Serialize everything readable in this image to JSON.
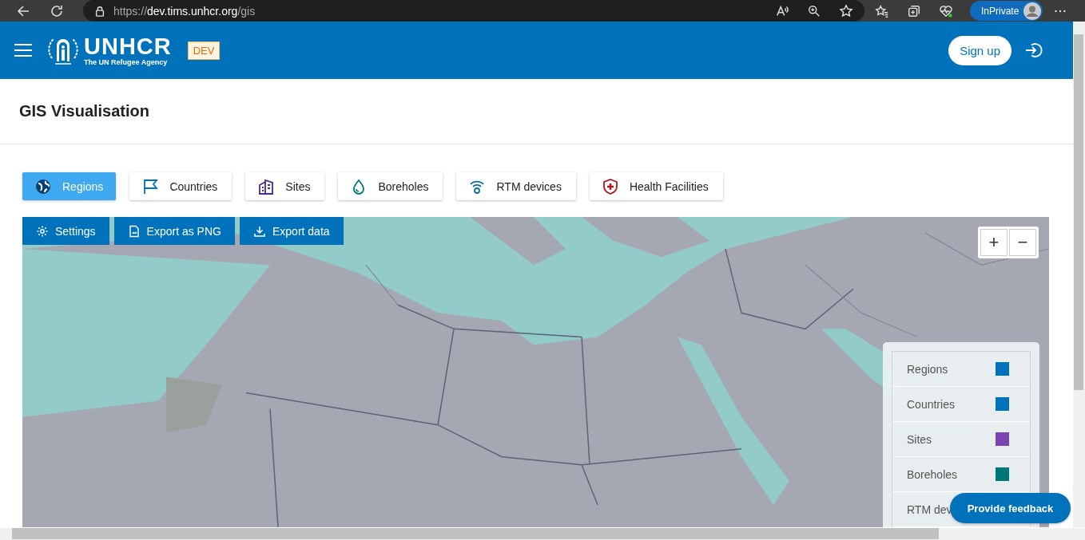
{
  "browser": {
    "url": "https://**dev.tims.unhcr.org**/gis",
    "profile": "InPrivate"
  },
  "header": {
    "logo": {
      "name": "UNHCR",
      "tagline": "The UN Refugee Agency"
    },
    "env_badge": "DEV",
    "signup": "Sign up"
  },
  "page_title": "GIS Visualisation",
  "tabs": [
    {
      "label": "Regions",
      "kind": "globe",
      "selected": true
    },
    {
      "label": "Countries",
      "kind": "flag",
      "selected": false
    },
    {
      "label": "Sites",
      "kind": "building",
      "selected": false
    },
    {
      "label": "Boreholes",
      "kind": "drop",
      "selected": false
    },
    {
      "label": "RTM devices",
      "kind": "signal",
      "selected": false
    },
    {
      "label": "Health Facilities",
      "kind": "health",
      "selected": false
    }
  ],
  "map": {
    "kind": "picture",
    "toolbar": [
      {
        "label": "Settings",
        "kind": "gear"
      },
      {
        "label": "Export as PNG",
        "kind": "file"
      },
      {
        "label": "Export data",
        "kind": "download"
      }
    ],
    "zoom": [
      "+",
      "−"
    ],
    "legend": [
      {
        "label": "Regions",
        "color": "#0072bc"
      },
      {
        "label": "Countries",
        "color": "#0072bc"
      },
      {
        "label": "Sites",
        "color": "#7b44b0"
      },
      {
        "label": "Boreholes",
        "color": "#00787a"
      },
      {
        "label": "RTM dev"
      }
    ]
  },
  "feedback": "Provide feedback"
}
